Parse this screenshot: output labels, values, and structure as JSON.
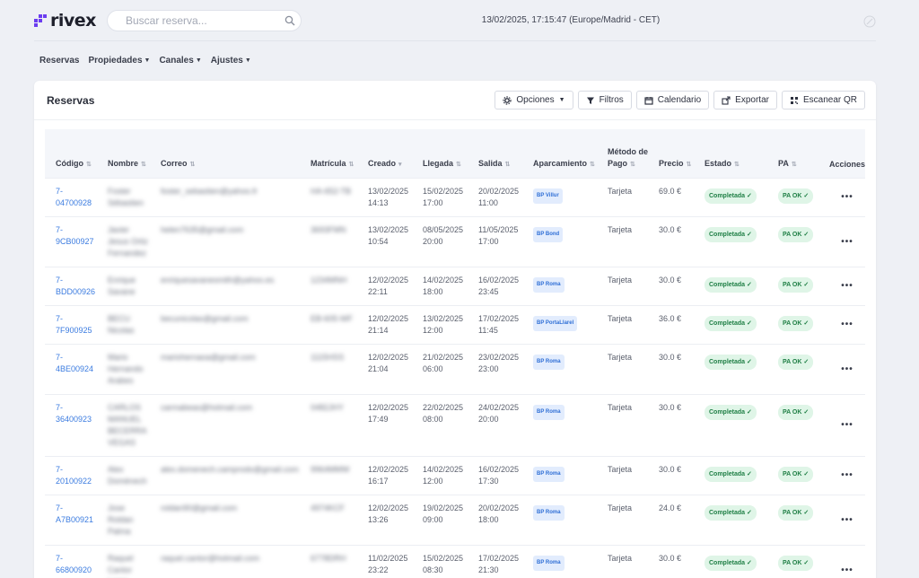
{
  "app": {
    "logo_text": "rivex"
  },
  "search": {
    "placeholder": "Buscar reserva..."
  },
  "datetime": "13/02/2025, 17:15:47 (Europe/Madrid - CET)",
  "nav": [
    {
      "label": "Reservas",
      "caret": false
    },
    {
      "label": "Propiedades",
      "caret": true
    },
    {
      "label": "Canales",
      "caret": true
    },
    {
      "label": "Ajustes",
      "caret": true
    }
  ],
  "card": {
    "title": "Reservas",
    "tools": [
      {
        "label": "Opciones",
        "icon": "gear-icon",
        "caret": true
      },
      {
        "label": "Filtros",
        "icon": "filter-icon",
        "caret": false
      },
      {
        "label": "Calendario",
        "icon": "calendar-icon",
        "caret": false
      },
      {
        "label": "Exportar",
        "icon": "export-icon",
        "caret": false
      },
      {
        "label": "Escanear QR",
        "icon": "qr-icon",
        "caret": false
      }
    ]
  },
  "table": {
    "columns": [
      {
        "key": "codigo",
        "label": "Código",
        "sort": "⇅"
      },
      {
        "key": "nombre",
        "label": "Nombre",
        "sort": "⇅"
      },
      {
        "key": "correo",
        "label": "Correo",
        "sort": "⇅"
      },
      {
        "key": "matricula",
        "label": "Matrícula",
        "sort": "⇅"
      },
      {
        "key": "creado",
        "label": "Creado",
        "sort": "▾"
      },
      {
        "key": "llegada",
        "label": "Llegada",
        "sort": "⇅"
      },
      {
        "key": "salida",
        "label": "Salida",
        "sort": "⇅"
      },
      {
        "key": "aparcamiento",
        "label": "Aparcamiento",
        "sort": "⇅"
      },
      {
        "key": "metodo",
        "label": "Método de Pago",
        "sort": "⇅"
      },
      {
        "key": "precio",
        "label": "Precio",
        "sort": "⇅"
      },
      {
        "key": "estado",
        "label": "Estado",
        "sort": "⇅"
      },
      {
        "key": "pa",
        "label": "PA",
        "sort": "⇅"
      },
      {
        "key": "acciones",
        "label": "Acciones",
        "sort": ""
      }
    ],
    "rows": [
      {
        "codigo": "7-04700928",
        "nombre": "Foster Sébastien",
        "correo": "foster_sebastien@yahoo.fr",
        "matricula": "HA-652-TB",
        "creado": "13/02/2025 14:13",
        "llegada": "15/02/2025 17:00",
        "salida": "20/02/2025 11:00",
        "aparcamiento": "BP Villur",
        "metodo": "Tarjeta",
        "precio": "69.0 €",
        "estado": "Completada ✓",
        "pa": "PA OK ✓"
      },
      {
        "codigo": "7-9CB00927",
        "nombre": "Javier Jesus Ortiz Fernandez",
        "correo": "helen7635@gmail.com",
        "matricula": "3693FMN",
        "creado": "13/02/2025 10:54",
        "llegada": "08/05/2025 20:00",
        "salida": "11/05/2025 17:00",
        "aparcamiento": "BP Bond",
        "metodo": "Tarjeta",
        "precio": "30.0 €",
        "estado": "Completada ✓",
        "pa": "PA OK ✓"
      },
      {
        "codigo": "7-BDD00926",
        "nombre": "Enrique Savane",
        "correo": "enriquesavanesmith@yahoo.es",
        "matricula": "1234MNH",
        "creado": "12/02/2025 22:11",
        "llegada": "14/02/2025 18:00",
        "salida": "16/02/2025 23:45",
        "aparcamiento": "BP Roma",
        "metodo": "Tarjeta",
        "precio": "30.0 €",
        "estado": "Completada ✓",
        "pa": "PA OK ✓"
      },
      {
        "codigo": "7-7F900925",
        "nombre": "BECU Nicolas",
        "correo": "becunicolas@gmail.com",
        "matricula": "EB-605-WF",
        "creado": "12/02/2025 21:14",
        "llegada": "13/02/2025 12:00",
        "salida": "17/02/2025 11:45",
        "aparcamiento": "BP PortaLlarel",
        "metodo": "Tarjeta",
        "precio": "36.0 €",
        "estado": "Completada ✓",
        "pa": "PA OK ✓"
      },
      {
        "codigo": "7-4BE00924",
        "nombre": "Mario Hernando Arabes",
        "correo": "mariohernaoa@gmail.com",
        "matricula": "1115HSS",
        "creado": "12/02/2025 21:04",
        "llegada": "21/02/2025 06:00",
        "salida": "23/02/2025 23:00",
        "aparcamiento": "BP Roma",
        "metodo": "Tarjeta",
        "precio": "30.0 €",
        "estado": "Completada ✓",
        "pa": "PA OK ✓"
      },
      {
        "codigo": "7-36400923",
        "nombre": "CARLOS MANUEL BECERRA VEGAS",
        "correo": "carmabeas@hotmail.com",
        "matricula": "0482JHY",
        "creado": "12/02/2025 17:49",
        "llegada": "22/02/2025 08:00",
        "salida": "24/02/2025 20:00",
        "aparcamiento": "BP Roma",
        "metodo": "Tarjeta",
        "precio": "30.0 €",
        "estado": "Completada ✓",
        "pa": "PA OK ✓"
      },
      {
        "codigo": "7-20100922",
        "nombre": "Alex Domènech",
        "correo": "alex.domenech.camprodo@gmail.com",
        "matricula": "9964MMW",
        "creado": "12/02/2025 16:17",
        "llegada": "14/02/2025 12:00",
        "salida": "16/02/2025 17:30",
        "aparcamiento": "BP Roma",
        "metodo": "Tarjeta",
        "precio": "30.0 €",
        "estado": "Completada ✓",
        "pa": "PA OK ✓"
      },
      {
        "codigo": "7-A7B00921",
        "nombre": "Jose Roldan Palma",
        "correo": "roldan90@gmail.com",
        "matricula": "4974KCF",
        "creado": "12/02/2025 13:26",
        "llegada": "19/02/2025 09:00",
        "salida": "20/02/2025 18:00",
        "aparcamiento": "BP Roma",
        "metodo": "Tarjeta",
        "precio": "24.0 €",
        "estado": "Completada ✓",
        "pa": "PA OK ✓"
      },
      {
        "codigo": "7-66800920",
        "nombre": "Raquel Cantor Lorez",
        "correo": "raquel.cantor@hotmail.com",
        "matricula": "6778DRH",
        "creado": "11/02/2025 23:22",
        "llegada": "15/02/2025 08:30",
        "salida": "17/02/2025 21:30",
        "aparcamiento": "BP Roma",
        "metodo": "Tarjeta",
        "precio": "30.0 €",
        "estado": "Completada ✓",
        "pa": "PA OK ✓"
      }
    ],
    "actions_label": "•••"
  }
}
